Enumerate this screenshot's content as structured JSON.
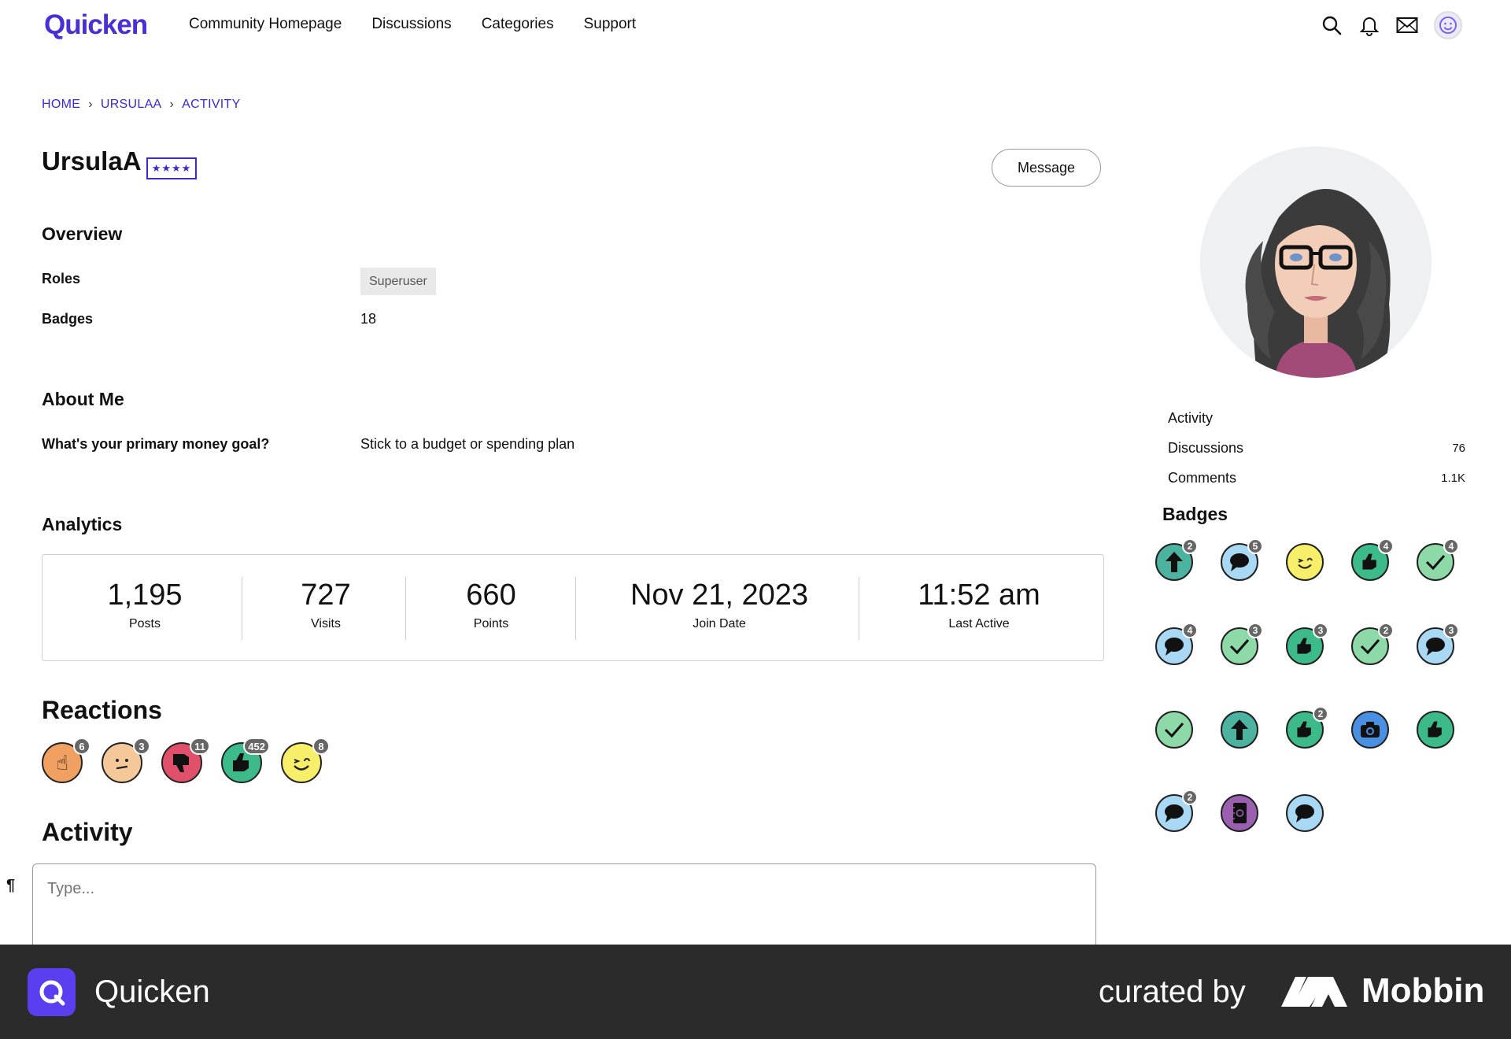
{
  "nav": {
    "logo": "Quicken",
    "links": [
      "Community Homepage",
      "Discussions",
      "Categories",
      "Support"
    ]
  },
  "breadcrumb": [
    "HOME",
    "URSULAA",
    "ACTIVITY"
  ],
  "breadcrumb_sep": "›",
  "profile": {
    "username": "UrsulaA",
    "rank_badge": "★★★★",
    "message_button": "Message"
  },
  "overview": {
    "title": "Overview",
    "roles_label": "Roles",
    "role_value": "Superuser",
    "badges_label": "Badges",
    "badges_value": "18"
  },
  "about": {
    "title": "About Me",
    "question": "What's your primary money goal?",
    "answer": "Stick to a budget or spending plan"
  },
  "analytics": {
    "title": "Analytics",
    "stats": [
      {
        "value": "1,195",
        "label": "Posts"
      },
      {
        "value": "727",
        "label": "Visits"
      },
      {
        "value": "660",
        "label": "Points"
      },
      {
        "value": "Nov 21, 2023",
        "label": "Join Date"
      },
      {
        "value": "11:52 am",
        "label": "Last Active"
      }
    ]
  },
  "reactions": {
    "title": "Reactions",
    "items": [
      {
        "icon": "pointing-hand-icon",
        "count": "6",
        "color": "#f0a060"
      },
      {
        "icon": "confused-face-icon",
        "count": "3",
        "color": "#f5c89a"
      },
      {
        "icon": "thumbs-down-icon",
        "count": "11",
        "color": "#e0506a"
      },
      {
        "icon": "thumbs-up-icon",
        "count": "452",
        "color": "#3dba8a"
      },
      {
        "icon": "laughing-face-icon",
        "count": "8",
        "color": "#f7ee6a"
      }
    ]
  },
  "activity": {
    "title": "Activity",
    "placeholder": "Type...",
    "format_icon": "¶"
  },
  "sidebar": {
    "activity_label": "Activity",
    "rows": [
      {
        "label": "Discussions",
        "value": "76"
      },
      {
        "label": "Comments",
        "value": "1.1K"
      }
    ],
    "badges_title": "Badges",
    "badges": [
      {
        "icon": "up-arrow-icon",
        "count": "2",
        "color": "#4bb3a0"
      },
      {
        "icon": "speech-bubble-icon",
        "count": "5",
        "color": "#a9d8f5"
      },
      {
        "icon": "laughing-face-icon",
        "count": "",
        "color": "#f7ee6a"
      },
      {
        "icon": "thumbs-up-icon",
        "count": "4",
        "color": "#3dba8a"
      },
      {
        "icon": "checkmark-icon",
        "count": "4",
        "color": "#8ed9a8"
      },
      {
        "icon": "speech-bubble-icon",
        "count": "4",
        "color": "#a9d8f5"
      },
      {
        "icon": "checkmark-icon",
        "count": "3",
        "color": "#8ed9a8"
      },
      {
        "icon": "thumbs-up-icon",
        "count": "3",
        "color": "#3dba8a"
      },
      {
        "icon": "checkmark-icon",
        "count": "2",
        "color": "#8ed9a8"
      },
      {
        "icon": "speech-bubble-icon",
        "count": "3",
        "color": "#a9d8f5"
      },
      {
        "icon": "checkmark-icon",
        "count": "",
        "color": "#8ed9a8"
      },
      {
        "icon": "up-arrow-icon",
        "count": "",
        "color": "#4bb3a0"
      },
      {
        "icon": "thumbs-up-icon",
        "count": "2",
        "color": "#3dba8a"
      },
      {
        "icon": "camera-icon",
        "count": "",
        "color": "#4a90e2"
      },
      {
        "icon": "thumbs-up-icon",
        "count": "",
        "color": "#3dba8a"
      },
      {
        "icon": "speech-bubble-icon",
        "count": "2",
        "color": "#a9d8f5"
      },
      {
        "icon": "address-book-icon",
        "count": "",
        "color": "#9b5fb0"
      },
      {
        "icon": "speech-bubble-icon",
        "count": "",
        "color": "#a9d8f5"
      }
    ]
  },
  "footer": {
    "app_name": "Quicken",
    "curated_by": "curated by",
    "brand": "Mobbin"
  },
  "colors": {
    "brand": "#4a2fd6",
    "link": "#3a2ad0",
    "footer_bg": "#2b2b2b"
  }
}
